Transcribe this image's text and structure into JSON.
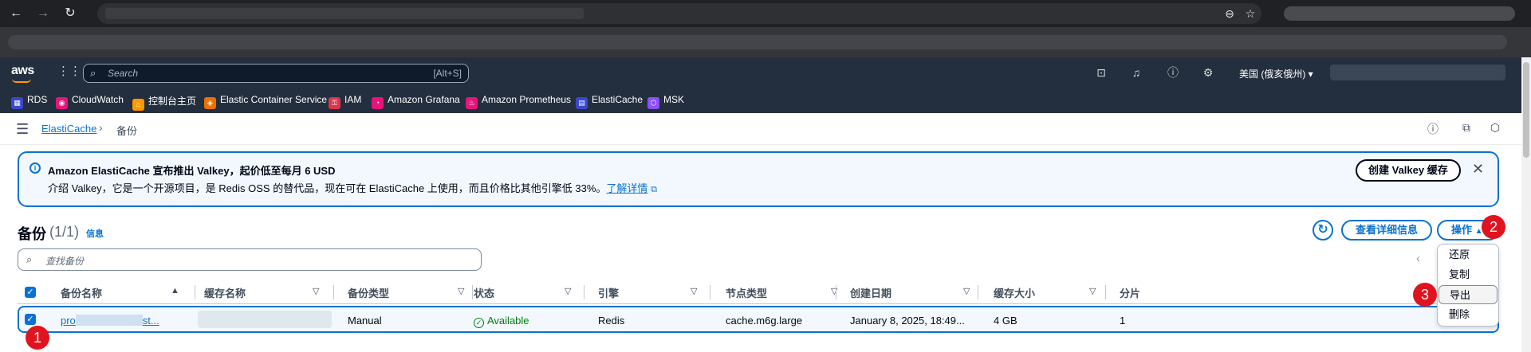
{
  "browser": {
    "back_icon": "arrow-left-icon",
    "forward_icon": "arrow-right-icon",
    "reload_icon": "reload-icon"
  },
  "aws": {
    "logo": "aws",
    "search_placeholder": "Search",
    "search_shortcut": "[Alt+S]",
    "region": "美国 (俄亥俄州) ▾"
  },
  "favorites": [
    {
      "label": "RDS",
      "color": "#3b48cc"
    },
    {
      "label": "CloudWatch",
      "color": "#e7157b"
    },
    {
      "label": "控制台主页",
      "color": "#ff9900"
    },
    {
      "label": "Elastic Container Service",
      "color": "#ed7100"
    },
    {
      "label": "IAM",
      "color": "#dd344c"
    },
    {
      "label": "Amazon Grafana",
      "color": "#e7157b"
    },
    {
      "label": "Amazon Prometheus",
      "color": "#e7157b"
    },
    {
      "label": "ElastiCache",
      "color": "#3b48cc"
    },
    {
      "label": "MSK",
      "color": "#8c4fff"
    }
  ],
  "breadcrumb": {
    "root": "ElastiCache",
    "separator": "›",
    "current": "备份"
  },
  "banner": {
    "title": "Amazon ElastiCache 宣布推出 Valkey，起价低至每月 6 USD",
    "desc": "介绍 Valkey，它是一个开源项目，是 Redis OSS 的替代品，现在可在 ElastiCache 上使用，而且价格比其他引擎低 33%。",
    "more": "了解详情",
    "button": "创建 Valkey 缓存"
  },
  "header": {
    "title": "备份",
    "count": "(1/1)",
    "info": "信息",
    "details_button": "查看详细信息",
    "actions_button": "操作"
  },
  "filter": {
    "placeholder": "查找备份"
  },
  "table": {
    "columns": [
      "备份名称",
      "缓存名称",
      "备份类型",
      "状态",
      "引擎",
      "节点类型",
      "创建日期",
      "缓存大小",
      "分片"
    ],
    "row": {
      "name_prefix": "pro",
      "name_suffix": "st...",
      "type": "Manual",
      "status": "Available",
      "engine": "Redis",
      "node_type": "cache.m6g.large",
      "created": "January 8, 2025, 18:49...",
      "size": "4 GB",
      "shards": "1"
    }
  },
  "menu": {
    "items": [
      "还原",
      "复制",
      "导出",
      "删除"
    ],
    "highlighted_index": 2
  },
  "badges": {
    "one": "1",
    "two": "2",
    "three": "3"
  }
}
